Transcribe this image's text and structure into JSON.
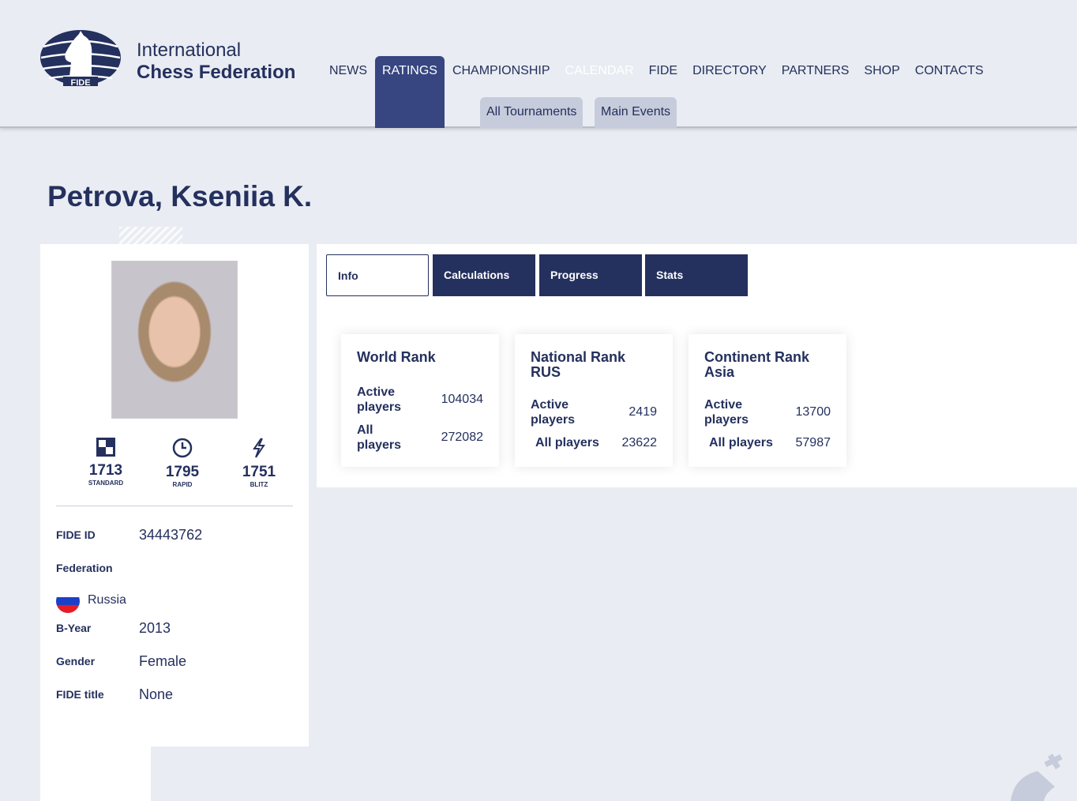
{
  "brand": {
    "line1": "International",
    "line2": "Chess Federation",
    "logo_text": "FIDE"
  },
  "nav": [
    "NEWS",
    "RATINGS",
    "CHAMPIONSHIP",
    "CALENDAR",
    "FIDE",
    "DIRECTORY",
    "PARTNERS",
    "SHOP",
    "CONTACTS"
  ],
  "subnav": [
    "All Tournaments",
    "Main Events"
  ],
  "player": {
    "name": "Petrova, Kseniia K.",
    "ratings": [
      {
        "value": "1713",
        "label": "STANDARD"
      },
      {
        "value": "1795",
        "label": "RAPID"
      },
      {
        "value": "1751",
        "label": "BLITZ"
      }
    ],
    "fide_id_label": "FIDE ID",
    "fide_id": "34443762",
    "federation_label": "Federation",
    "federation": "Russia",
    "byear_label": "B-Year",
    "byear": "2013",
    "gender_label": "Gender",
    "gender": "Female",
    "title_label": "FIDE title",
    "title": "None"
  },
  "tabs": [
    "Info",
    "Calculations",
    "Progress",
    "Stats"
  ],
  "cards": [
    {
      "title": "World Rank",
      "active_label": "Active players",
      "active": "104034",
      "all_label": "All players",
      "all": "272082"
    },
    {
      "title": "National Rank RUS",
      "active_label": "Active players",
      "active": "2419",
      "all_label": "All players",
      "all": "23622"
    },
    {
      "title": "Continent Rank Asia",
      "active_label": "Active players",
      "active": "13700",
      "all_label": "All players",
      "all": "57987"
    }
  ]
}
